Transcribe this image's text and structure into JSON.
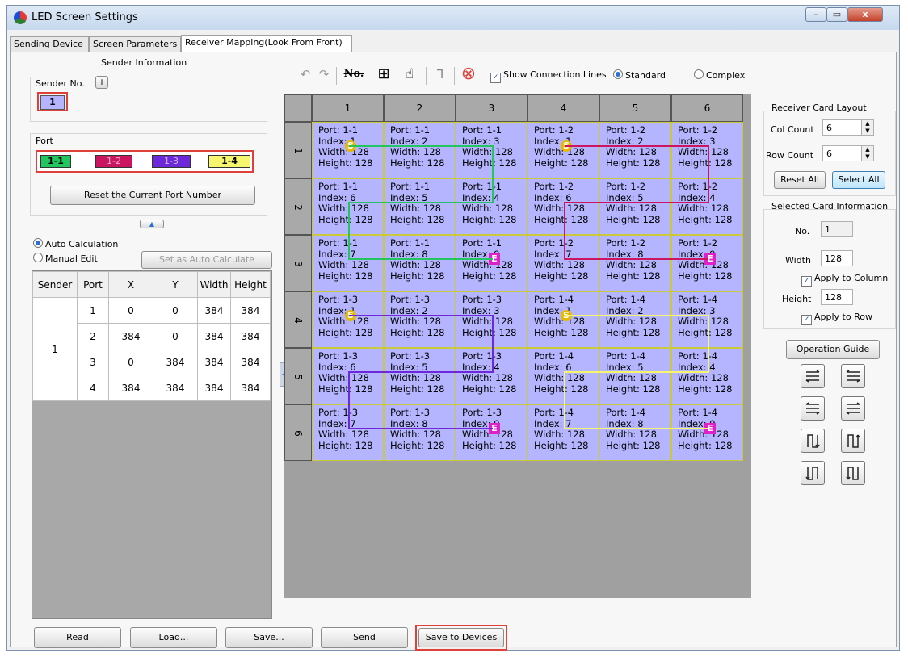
{
  "window": {
    "title": "LED Screen Settings",
    "min": "–",
    "max": "▭",
    "close": "x"
  },
  "tabs": [
    "Sending Device",
    "Screen Parameters",
    "Receiver Mapping(Look From Front)"
  ],
  "sender": {
    "group_title": "Sender Information",
    "sender_no_label": "Sender No.",
    "add_btn": "+",
    "sender_value": "1",
    "port_label": "Port",
    "ports": [
      {
        "label": "1-1",
        "color": "#22c55e"
      },
      {
        "label": "1-2",
        "color": "#cc1560"
      },
      {
        "label": "1-3",
        "color": "#6d28d9"
      },
      {
        "label": "1-4",
        "color": "#f5f56e"
      }
    ],
    "reset_port_btn": "Reset the Current Port Number",
    "collapse_btn": "▲",
    "auto_calc": "Auto Calculation",
    "manual_edit": "Manual Edit",
    "set_auto_btn": "Set as Auto Calculate"
  },
  "port_table": {
    "headers": [
      "Sender",
      "Port",
      "X",
      "Y",
      "Width",
      "Height"
    ],
    "sender": "1",
    "rows": [
      [
        "1",
        "0",
        "0",
        "384",
        "384"
      ],
      [
        "2",
        "384",
        "0",
        "384",
        "384"
      ],
      [
        "3",
        "0",
        "384",
        "384",
        "384"
      ],
      [
        "4",
        "384",
        "384",
        "384",
        "384"
      ]
    ]
  },
  "toolbar": {
    "undo": "↶",
    "redo": "↷",
    "no": "No.",
    "grid": "⊞",
    "hand": "☝",
    "bracket": "⅂",
    "clear": "⊗",
    "show_lines": "Show Connection Lines",
    "standard": "Standard",
    "complex": "Complex"
  },
  "grid": {
    "cols": [
      "1",
      "2",
      "3",
      "4",
      "5",
      "6"
    ],
    "rows": [
      "1",
      "2",
      "3",
      "4",
      "5",
      "6"
    ],
    "cards": [
      [
        {
          "p": "Port: 1-1",
          "i": "Index: 1",
          "m": "S"
        },
        {
          "p": "Port: 1-1",
          "i": "Index: 2"
        },
        {
          "p": "Port: 1-1",
          "i": "Index: 3"
        },
        {
          "p": "Port: 1-2",
          "i": "Index: 1",
          "m": "S"
        },
        {
          "p": "Port: 1-2",
          "i": "Index: 2"
        },
        {
          "p": "Port: 1-2",
          "i": "Index: 3"
        }
      ],
      [
        {
          "p": "Port: 1-1",
          "i": "Index: 6"
        },
        {
          "p": "Port: 1-1",
          "i": "Index: 5"
        },
        {
          "p": "Port: 1-1",
          "i": "Index: 4"
        },
        {
          "p": "Port: 1-2",
          "i": "Index: 6"
        },
        {
          "p": "Port: 1-2",
          "i": "Index: 5"
        },
        {
          "p": "Port: 1-2",
          "i": "Index: 4"
        }
      ],
      [
        {
          "p": "Port: 1-1",
          "i": "Index: 7"
        },
        {
          "p": "Port: 1-1",
          "i": "Index: 8"
        },
        {
          "p": "Port: 1-1",
          "i": "Index: 9",
          "m": "E"
        },
        {
          "p": "Port: 1-2",
          "i": "Index: 7"
        },
        {
          "p": "Port: 1-2",
          "i": "Index: 8"
        },
        {
          "p": "Port: 1-2",
          "i": "Index: 9",
          "m": "E"
        }
      ],
      [
        {
          "p": "Port: 1-3",
          "i": "Index: 1",
          "m": "S"
        },
        {
          "p": "Port: 1-3",
          "i": "Index: 2"
        },
        {
          "p": "Port: 1-3",
          "i": "Index: 3"
        },
        {
          "p": "Port: 1-4",
          "i": "Index: 1",
          "m": "S"
        },
        {
          "p": "Port: 1-4",
          "i": "Index: 2"
        },
        {
          "p": "Port: 1-4",
          "i": "Index: 3"
        }
      ],
      [
        {
          "p": "Port: 1-3",
          "i": "Index: 6"
        },
        {
          "p": "Port: 1-3",
          "i": "Index: 5"
        },
        {
          "p": "Port: 1-3",
          "i": "Index: 4"
        },
        {
          "p": "Port: 1-4",
          "i": "Index: 6"
        },
        {
          "p": "Port: 1-4",
          "i": "Index: 5"
        },
        {
          "p": "Port: 1-4",
          "i": "Index: 4"
        }
      ],
      [
        {
          "p": "Port: 1-3",
          "i": "Index: 7"
        },
        {
          "p": "Port: 1-3",
          "i": "Index: 8"
        },
        {
          "p": "Port: 1-3",
          "i": "Index: 9",
          "m": "E"
        },
        {
          "p": "Port: 1-4",
          "i": "Index: 7"
        },
        {
          "p": "Port: 1-4",
          "i": "Index: 8"
        },
        {
          "p": "Port: 1-4",
          "i": "Index: 9",
          "m": "E"
        }
      ]
    ],
    "width_text": "Width: 128",
    "height_text": "Height: 128",
    "card_color": "#b4b4ff",
    "line_colors": [
      "#22c55e",
      "#cc1560",
      "#6d28d9",
      "#f5f56e"
    ]
  },
  "layout_panel": {
    "title": "Receiver Card Layout",
    "col_label": "Col Count",
    "col_value": "6",
    "row_label": "Row Count",
    "row_value": "6",
    "reset_all": "Reset All",
    "select_all": "Select All"
  },
  "selected_panel": {
    "title": "Selected Card Information",
    "no_label": "No.",
    "no_value": "1",
    "width_label": "Width",
    "width_value": "128",
    "apply_col": "Apply to Column",
    "height_label": "Height",
    "height_value": "128",
    "apply_row": "Apply to Row"
  },
  "op_guide": "Operation Guide",
  "bottom": {
    "read": "Read",
    "load": "Load...",
    "save": "Save...",
    "send": "Send",
    "save_devices": "Save to Devices"
  }
}
